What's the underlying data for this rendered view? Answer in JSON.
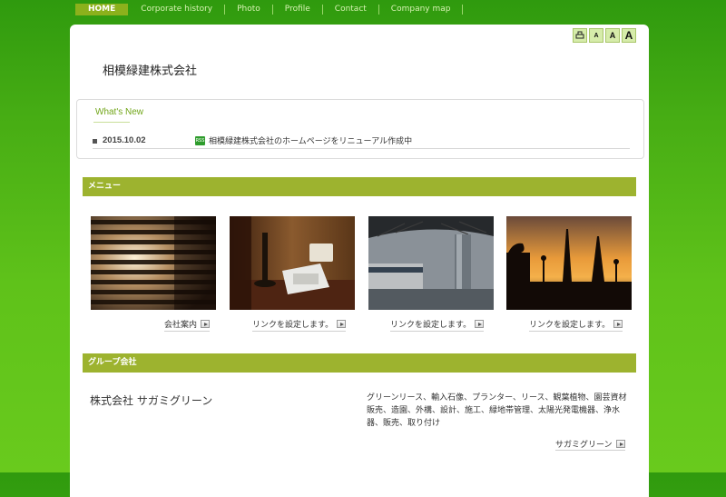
{
  "nav": {
    "items": [
      {
        "label": "HOME",
        "active": true
      },
      {
        "label": "Corporate history"
      },
      {
        "label": "Photo"
      },
      {
        "label": "Profile"
      },
      {
        "label": "Contact"
      },
      {
        "label": "Company map"
      }
    ]
  },
  "font_size_controls": {
    "print_icon": "print-icon",
    "small": "A",
    "medium": "A",
    "large": "A"
  },
  "site": {
    "title": "相模緑建株式会社"
  },
  "news": {
    "heading": "What's New",
    "items": [
      {
        "date": "2015.10.02",
        "icon": "new-icon",
        "text": "相模緑建株式会社のホームページをリニューアル作成中"
      }
    ]
  },
  "menu": {
    "heading": "メニュー",
    "items": [
      {
        "label": "会社案内",
        "image": "window-blinds-photo"
      },
      {
        "label": "リンクを設定します。",
        "image": "telephone-lamp-photo"
      },
      {
        "label": "リンクを設定します。",
        "image": "train-station-photo"
      },
      {
        "label": "リンクを設定します。",
        "image": "paris-sunset-photo"
      }
    ]
  },
  "group": {
    "heading": "グループ会社",
    "company_name": "株式会社 サガミグリーン",
    "description": "グリーンリース、輸入石像、プランター、リース、観葉植物、園芸資材販売、造園、外構、設計、施工、緑地帯管理、太陽光発電機器、浄水器、販売、取り付け",
    "link_label": "サガミグリーン"
  },
  "colors": {
    "accent": "#9db32f",
    "background": "#47ad14",
    "nav_active": "#8cb11c"
  }
}
